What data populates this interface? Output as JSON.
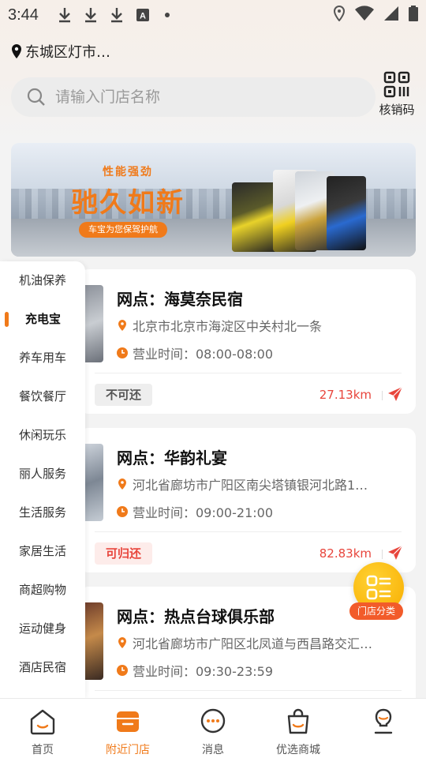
{
  "status_bar": {
    "time": "3:44",
    "icons": [
      "download-icon",
      "download-icon",
      "download-icon",
      "a-box-icon",
      "dot-icon",
      "location-icon",
      "wifi-icon",
      "signal-icon",
      "battery-icon"
    ]
  },
  "location": {
    "label": "东城区灯市…"
  },
  "search": {
    "placeholder": "请输入门店名称"
  },
  "verify": {
    "label": "核销码"
  },
  "banner": {
    "tag": "性能强劲",
    "title": "驰久如新",
    "pill": "车宝为您保驾护航"
  },
  "categories": {
    "items": [
      {
        "label": "机油保养",
        "active": false
      },
      {
        "label": "充电宝",
        "active": true
      },
      {
        "label": "养车用车",
        "active": false
      },
      {
        "label": "餐饮餐厅",
        "active": false
      },
      {
        "label": "休闲玩乐",
        "active": false
      },
      {
        "label": "丽人服务",
        "active": false
      },
      {
        "label": "生活服务",
        "active": false
      },
      {
        "label": "家居生活",
        "active": false
      },
      {
        "label": "商超购物",
        "active": false
      },
      {
        "label": "运动健身",
        "active": false
      },
      {
        "label": "酒店民宿",
        "active": false
      }
    ]
  },
  "stores": [
    {
      "name": "网点：海莫奈民宿",
      "address": "北京市北京市海淀区中关村北一条",
      "hours": "营业时间：08:00-08:00",
      "badge": "不可还",
      "badge_type": "no",
      "distance": "27.13km"
    },
    {
      "name": "网点：华韵礼宴",
      "address": "河北省廊坊市广阳区南尖塔镇银河北路1…",
      "hours": "营业时间：09:00-21:00",
      "badge": "可归还",
      "badge_type": "yes",
      "distance": "82.83km"
    },
    {
      "name": "网点：热点台球俱乐部",
      "address": "河北省廊坊市广阳区北凤道与西昌路交汇…",
      "hours": "营业时间：09:30-23:59",
      "badge": "",
      "badge_type": "",
      "distance": ""
    }
  ],
  "fab": {
    "label": "门店分类"
  },
  "tabs": [
    {
      "label": "首页",
      "icon": "home-icon",
      "active": false
    },
    {
      "label": "附近门店",
      "icon": "store-icon",
      "active": true
    },
    {
      "label": "消息",
      "icon": "message-icon",
      "active": false
    },
    {
      "label": "优选商城",
      "icon": "shopping-bag-icon",
      "active": false
    },
    {
      "label": "",
      "icon": "profile-icon",
      "active": false
    }
  ],
  "colors": {
    "accent": "#f07a1a",
    "danger": "#e8453c",
    "fab": "#f8ad00"
  }
}
